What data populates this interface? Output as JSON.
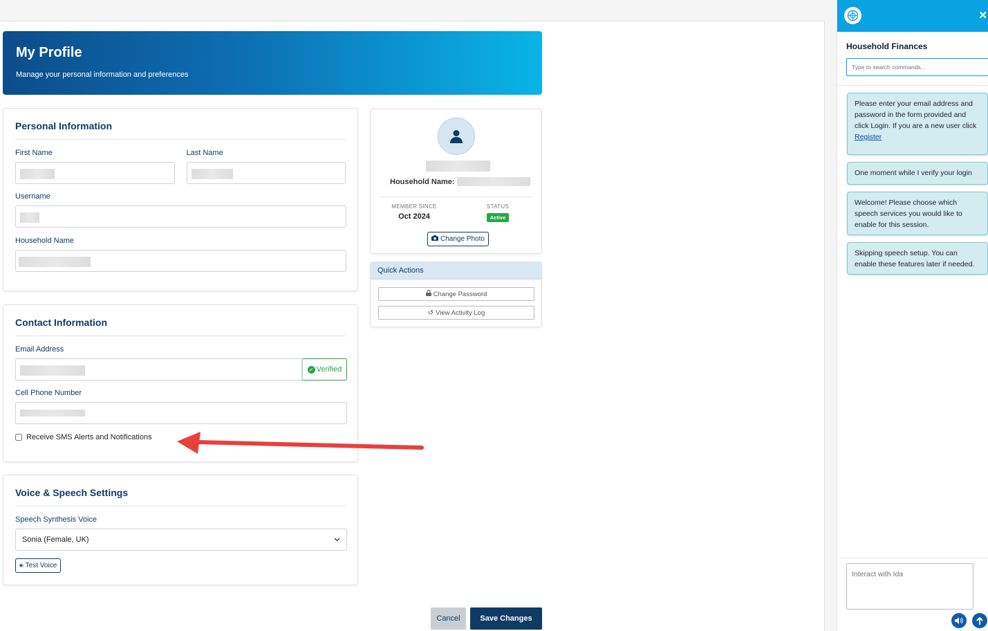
{
  "header": {
    "title": "My Profile",
    "subtitle": "Manage your personal information and preferences"
  },
  "personal": {
    "title": "Personal Information",
    "first_name_label": "First Name",
    "last_name_label": "Last Name",
    "username_label": "Username",
    "household_label": "Household Name"
  },
  "contact": {
    "title": "Contact Information",
    "email_label": "Email Address",
    "verified_label": "Verified",
    "phone_label": "Cell Phone Number",
    "sms_label": "Receive SMS Alerts and Notifications"
  },
  "voice": {
    "title": "Voice & Speech Settings",
    "voice_label": "Speech Synthesis Voice",
    "voice_value": "Sonia (Female, UK)",
    "test_label": "Test Voice"
  },
  "profile_card": {
    "household_label": "Household Name:",
    "member_since_label": "MEMBER SINCE",
    "member_since_value": "Oct 2024",
    "status_label": "STATUS",
    "status_value": "Active",
    "change_photo_label": "Change Photo"
  },
  "quick_actions": {
    "title": "Quick Actions",
    "change_password": "Change Password",
    "activity_log": "View Activity Log"
  },
  "footer": {
    "cancel": "Cancel",
    "save": "Save Changes"
  },
  "sidebar": {
    "title": "Household Finances",
    "search_placeholder": "Type to search commands...",
    "messages": [
      "Please enter your email address and password in the form provided and click Login. If you are a new user click",
      "One moment while I verify your login",
      "Welcome! Please choose which speech services you would like to enable for this session.",
      "Skipping speech setup. You can enable these features later if needed."
    ],
    "register_link": "Register",
    "chat_placeholder": "Interact with Ida"
  },
  "colors": {
    "primary": "#123a63",
    "accent": "#0aa2e0",
    "success": "#28a745",
    "arrow": "#e8403b"
  }
}
